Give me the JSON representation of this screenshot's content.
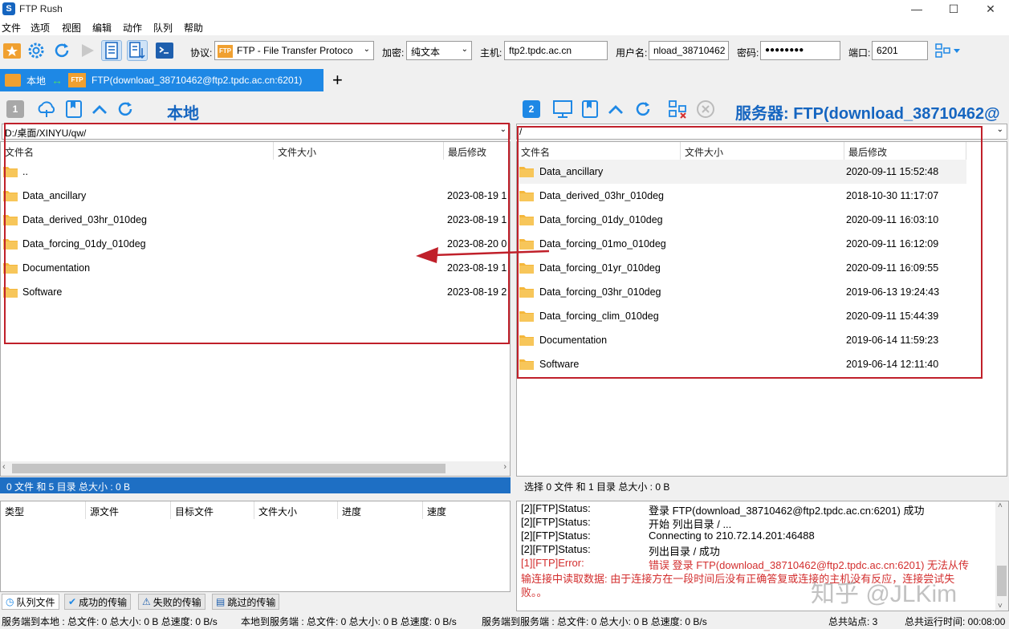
{
  "window": {
    "title": "FTP Rush",
    "app_icon_letter": "S"
  },
  "menu": [
    "文件",
    "选项",
    "视图",
    "编辑",
    "动作",
    "队列",
    "帮助"
  ],
  "toolbar": {
    "protocol_label": "协议:",
    "protocol_value": "FTP - File Transfer Protoco",
    "encryption_label": "加密:",
    "encryption_value": "纯文本",
    "host_label": "主机:",
    "host_value": "ftp2.tpdc.ac.cn",
    "user_label": "用户名:",
    "user_value": "nload_38710462",
    "password_label": "密码:",
    "password_value": "●●●●●●●●",
    "port_label": "端口:",
    "port_value": "6201"
  },
  "tabs": {
    "local": "本地",
    "remote": "FTP(download_38710462@ftp2.tpdc.ac.cn:6201)",
    "add": "+"
  },
  "local_panel": {
    "number": "1",
    "title": "本地",
    "path": "D:/桌面/XINYU/qw/",
    "columns": [
      "文件名",
      "文件大小",
      "最后修改"
    ],
    "files": [
      {
        "name": "..",
        "date": ""
      },
      {
        "name": "Data_ancillary",
        "date": "2023-08-19 1"
      },
      {
        "name": "Data_derived_03hr_010deg",
        "date": "2023-08-19 1"
      },
      {
        "name": "Data_forcing_01dy_010deg",
        "date": "2023-08-20 0"
      },
      {
        "name": "Documentation",
        "date": "2023-08-19 1"
      },
      {
        "name": "Software",
        "date": "2023-08-19 2"
      }
    ],
    "status": "0 文件 和 5 目录 总大小 : 0 B"
  },
  "remote_panel": {
    "number": "2",
    "title": "服务器:  FTP(download_38710462@",
    "path": "/",
    "columns": [
      "文件名",
      "文件大小",
      "最后修改"
    ],
    "files": [
      {
        "name": "Data_ancillary",
        "date": "2020-09-11 15:52:48"
      },
      {
        "name": "Data_derived_03hr_010deg",
        "date": "2018-10-30 11:17:07"
      },
      {
        "name": "Data_forcing_01dy_010deg",
        "date": "2020-09-11 16:03:10"
      },
      {
        "name": "Data_forcing_01mo_010deg",
        "date": "2020-09-11 16:12:09"
      },
      {
        "name": "Data_forcing_01yr_010deg",
        "date": "2020-09-11 16:09:55"
      },
      {
        "name": "Data_forcing_03hr_010deg",
        "date": "2019-06-13 19:24:43"
      },
      {
        "name": "Data_forcing_clim_010deg",
        "date": "2020-09-11 15:44:39"
      },
      {
        "name": "Documentation",
        "date": "2019-06-14 11:59:23"
      },
      {
        "name": "Software",
        "date": "2019-06-14 12:11:40"
      }
    ],
    "status": "选择 0 文件 和 1 目录 总大小 : 0 B"
  },
  "queue": {
    "columns": [
      "类型",
      "源文件",
      "目标文件",
      "文件大小",
      "进度",
      "速度"
    ],
    "tabs": [
      "队列文件",
      "成功的传输",
      "失败的传输",
      "跳过的传输"
    ]
  },
  "log": [
    {
      "src": "[2][FTP]Status:",
      "msg": "登录 FTP(download_38710462@ftp2.tpdc.ac.cn:6201) 成功",
      "error": false
    },
    {
      "src": "[2][FTP]Status:",
      "msg": "开始 列出目录 / ...",
      "error": false
    },
    {
      "src": "[2][FTP]Status:",
      "msg": "Connecting to 210.72.14.201:46488",
      "error": false
    },
    {
      "src": "[2][FTP]Status:",
      "msg": "列出目录 / 成功",
      "error": false
    },
    {
      "src": "[1][FTP]Error:",
      "msg": "错误 登录 FTP(download_38710462@ftp2.tpdc.ac.cn:6201) 无法从传",
      "error": true
    }
  ],
  "log_error_cont1": "输连接中读取数据: 由于连接方在一段时间后没有正确答复或连接的主机没有反应，连接尝试失",
  "log_error_cont2": "败。。",
  "watermark": "知乎 @JLKim",
  "bottom": {
    "s2l": "服务端到本地 : 总文件: 0  总大小: 0 B  总速度: 0 B/s",
    "l2s": "本地到服务端 : 总文件: 0  总大小: 0 B  总速度: 0 B/s",
    "s2s": "服务端到服务端 : 总文件: 0  总大小: 0 B  总速度: 0 B/s",
    "sites": "总共站点: 3",
    "runtime": "总共运行时间: 00:08:00"
  },
  "colors": {
    "accent": "#1e88e5",
    "title_blue": "#1565c0",
    "annotation_red": "#c0202a",
    "folder": "#f5b73b",
    "error": "#d32f2f"
  }
}
